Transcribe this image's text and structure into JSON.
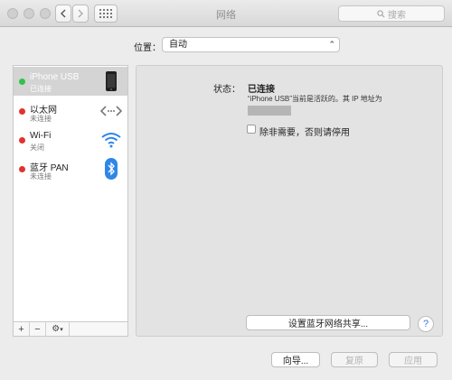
{
  "window": {
    "title": "网络"
  },
  "search": {
    "placeholder": "搜索"
  },
  "location": {
    "label": "位置：",
    "value": "自动"
  },
  "services": [
    {
      "name": "iPhone USB",
      "status": "已连接",
      "dot": "#2fc24a",
      "icon": "iphone-icon",
      "selected": true
    },
    {
      "name": "以太网",
      "status": "未连接",
      "dot": "#e3322f",
      "icon": "ethernet-icon",
      "selected": false
    },
    {
      "name": "Wi-Fi",
      "status": "关闭",
      "dot": "#e3322f",
      "icon": "wifi-icon",
      "selected": false
    },
    {
      "name": "蓝牙 PAN",
      "status": "未连接",
      "dot": "#e3322f",
      "icon": "bluetooth-icon",
      "selected": false
    }
  ],
  "sidebar_toolbar": {
    "add": "+",
    "remove": "−",
    "gear": "⚙"
  },
  "detail": {
    "status_label": "状态：",
    "status_value": "已连接",
    "status_desc": "“iPhone USB”当前是活跃的。其 IP 地址为",
    "checkbox_label": "除非需要，否则请停用",
    "share_button": "设置蓝牙网络共享...",
    "help": "?"
  },
  "footer": {
    "assistant": "向导...",
    "revert": "复原",
    "apply": "应用"
  }
}
